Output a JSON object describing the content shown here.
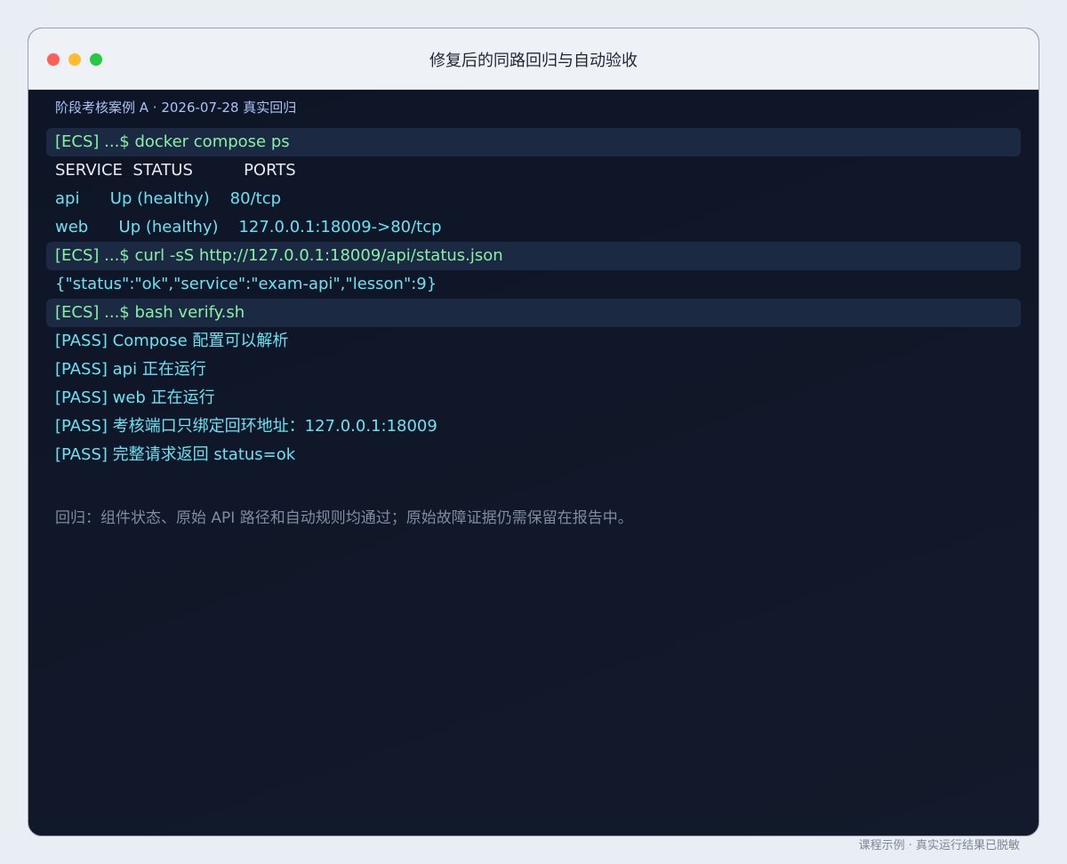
{
  "window": {
    "title": "修复后的同路回归与自动验收"
  },
  "case_label": "阶段考核案例 A · 2026-07-28 真实回归",
  "terminal": {
    "lines": [
      {
        "type": "cmd",
        "text": "[ECS] ...$ docker compose ps"
      },
      {
        "type": "header",
        "text": "SERVICE  STATUS          PORTS"
      },
      {
        "type": "out",
        "text": "api      Up (healthy)    80/tcp"
      },
      {
        "type": "out",
        "text": "web      Up (healthy)    127.0.0.1:18009->80/tcp"
      },
      {
        "type": "cmd",
        "text": "[ECS] ...$ curl -sS http://127.0.0.1:18009/api/status.json"
      },
      {
        "type": "out",
        "text": "{\"status\":\"ok\",\"service\":\"exam-api\",\"lesson\":9}"
      },
      {
        "type": "cmd",
        "text": "[ECS] ...$ bash verify.sh"
      },
      {
        "type": "out",
        "text": "[PASS] Compose 配置可以解析"
      },
      {
        "type": "out",
        "text": "[PASS] api 正在运行"
      },
      {
        "type": "out",
        "text": "[PASS] web 正在运行"
      },
      {
        "type": "out",
        "text": "[PASS] 考核端口只绑定回环地址：127.0.0.1:18009"
      },
      {
        "type": "out",
        "text": "[PASS] 完整请求返回 status=ok"
      }
    ]
  },
  "summary": "回归：组件状态、原始 API 路径和自动规则均通过；原始故障证据仍需保留在报告中。",
  "footer": "课程示例 · 真实运行结果已脱敏",
  "colors": {
    "page_bg": "#e9edf4",
    "terminal_bg": "#0f1727",
    "command_row_bg": "#1c2942",
    "command_text": "#86f0a6",
    "output_text": "#67e3f3",
    "header_text": "#e6ebf3",
    "case_label": "#a7c4f5",
    "summary_text": "#7f8ba0"
  }
}
